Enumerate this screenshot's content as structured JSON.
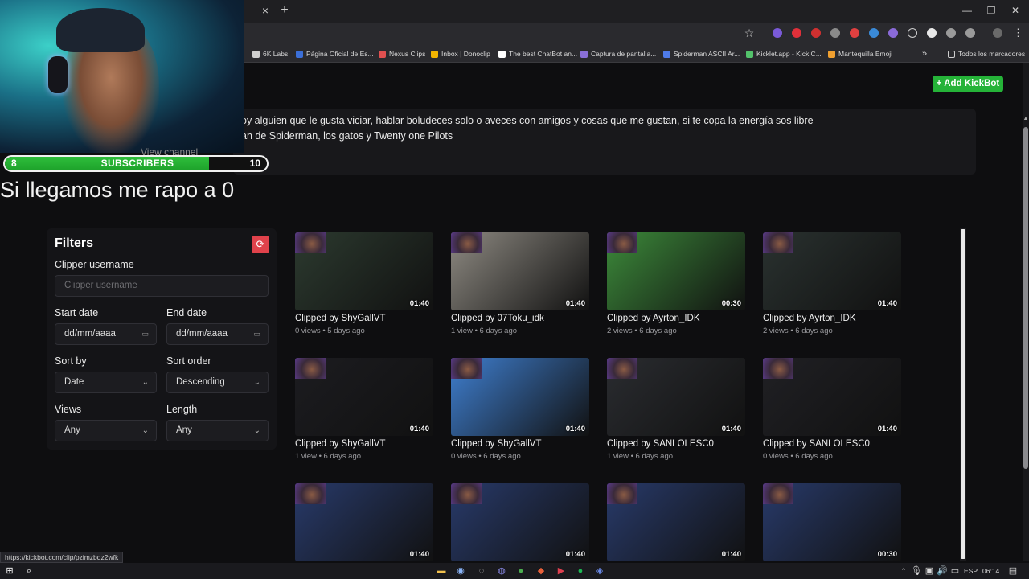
{
  "browser": {
    "tab_close": "×",
    "new_tab": "+",
    "bookmarks": [
      {
        "label": "6K Labs",
        "color": "#cfcfcf"
      },
      {
        "label": "Página Oficial de Es...",
        "color": "#3b6fd8"
      },
      {
        "label": "Nexus Clips",
        "color": "#e05050"
      },
      {
        "label": "Inbox | Donoclip",
        "color": "#f2b400"
      },
      {
        "label": "The best ChatBot an...",
        "color": "#ffffff"
      },
      {
        "label": "Captura de pantalla...",
        "color": "#8a6fd8"
      },
      {
        "label": "Spiderman ASCII Ar...",
        "color": "#4f7be8"
      },
      {
        "label": "Kicklet.app - Kick C...",
        "color": "#53c26b"
      },
      {
        "label": "Mantequilla Emoji",
        "color": "#f0a030"
      }
    ],
    "bookmarks_overflow": "»",
    "all_bookmarks": "Todos los marcadores"
  },
  "overlay": {
    "subscribers": {
      "start": "8",
      "label": "SUBSCRIBERS",
      "goal": "10",
      "progress": 0.78
    },
    "goal_text": "Si llegamos me rapo a 0"
  },
  "channel": {
    "about_line1": "oy alguien que le gusta viciar, hablar boludeces solo o aveces con amigos y cosas que me gustan, si te copa la energía sos libre",
    "about_line2": "an de Spiderman, los gatos y Twenty one Pilots",
    "view_channel": "View channel",
    "add_kickbot": "+ Add KickBot"
  },
  "filters": {
    "title": "Filters",
    "clipper_label": "Clipper username",
    "clipper_placeholder": "Clipper username",
    "start_label": "Start date",
    "start_value": "dd/mm/aaaa",
    "end_label": "End date",
    "end_value": "dd/mm/aaaa",
    "sort_by_label": "Sort by",
    "sort_by_value": "Date",
    "sort_order_label": "Sort order",
    "sort_order_value": "Descending",
    "views_label": "Views",
    "views_value": "Any",
    "length_label": "Length",
    "length_value": "Any"
  },
  "clips": [
    {
      "title": "Clipped by ShyGallVT",
      "meta": "0 views • 5 days ago",
      "duration": "01:40",
      "bg": "#2c3a2f"
    },
    {
      "title": "Clipped by 07Toku_idk",
      "meta": "1 view • 6 days ago",
      "duration": "01:40",
      "bg": "#8e8a82"
    },
    {
      "title": "Clipped by Ayrton_IDK",
      "meta": "2 views • 6 days ago",
      "duration": "00:30",
      "bg": "#3c8a3a"
    },
    {
      "title": "Clipped by Ayrton_IDK",
      "meta": "2 views • 6 days ago",
      "duration": "01:40",
      "bg": "#2a3230"
    },
    {
      "title": "Clipped by ShyGallVT",
      "meta": "1 view • 6 days ago",
      "duration": "01:40",
      "bg": "#1c1c20"
    },
    {
      "title": "Clipped by ShyGallVT",
      "meta": "0 views • 6 days ago",
      "duration": "01:40",
      "bg": "#3f7fd0"
    },
    {
      "title": "Clipped by SANLOLESC0",
      "meta": "1 view • 6 days ago",
      "duration": "01:40",
      "bg": "#2a2c30"
    },
    {
      "title": "Clipped by SANLOLESC0",
      "meta": "0 views • 6 days ago",
      "duration": "01:40",
      "bg": "#202024"
    },
    {
      "title": "",
      "meta": "",
      "duration": "01:40",
      "bg": "#283a6a"
    },
    {
      "title": "",
      "meta": "",
      "duration": "01:40",
      "bg": "#283a6a"
    },
    {
      "title": "",
      "meta": "",
      "duration": "01:40",
      "bg": "#283a6a"
    },
    {
      "title": "",
      "meta": "",
      "duration": "00:30",
      "bg": "#283a6a"
    }
  ],
  "status_url": "https://kickbot.com/clip/pzimzbdz2wfk",
  "taskbar": {
    "lang": "ESP",
    "time": "06:14"
  }
}
